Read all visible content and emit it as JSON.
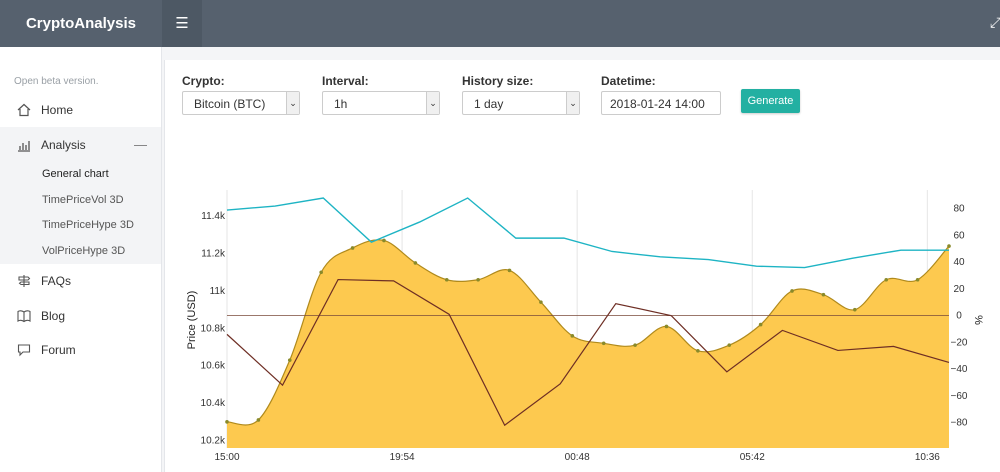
{
  "app": {
    "title": "CryptoAnalysis"
  },
  "sidebar": {
    "beta_note": "Open beta version.",
    "items": [
      {
        "label": "Home",
        "icon": "home-icon"
      },
      {
        "label": "Analysis",
        "icon": "bar-chart-icon",
        "expanded": true,
        "children": [
          "General chart",
          "TimePriceVol 3D",
          "TimePriceHype 3D",
          "VolPriceHype 3D"
        ]
      },
      {
        "label": "FAQs",
        "icon": "signpost-icon"
      },
      {
        "label": "Blog",
        "icon": "book-icon"
      },
      {
        "label": "Forum",
        "icon": "chat-icon"
      }
    ]
  },
  "form": {
    "crypto": {
      "label": "Crypto:",
      "value": "Bitcoin (BTC)"
    },
    "interval": {
      "label": "Interval:",
      "value": "1h"
    },
    "history": {
      "label": "History size:",
      "value": "1 day"
    },
    "datetime": {
      "label": "Datetime:",
      "value": "2018-01-24 14:00"
    },
    "generate_label": "Generate"
  },
  "colors": {
    "price_fill": "#fdc94f",
    "price_line": "#b08a1c",
    "teal": "#1eb4c4",
    "dark": "#6e2e24",
    "button": "#23b0a2"
  },
  "chart_data": {
    "type": "line",
    "ylabel": "Price (USD)",
    "y2label": "%",
    "x_ticks": [
      "15:00",
      "19:54",
      "00:48",
      "05:42",
      "10:36"
    ],
    "x": [
      0,
      1,
      2,
      3,
      4,
      5,
      6,
      7,
      8,
      9,
      10,
      11,
      12,
      13,
      14,
      15,
      16,
      17,
      18,
      19,
      20,
      21,
      22,
      23
    ],
    "y_ticks": [
      "10.2k",
      "10.4k",
      "10.6k",
      "10.8k",
      "11k",
      "11.2k",
      "11.4k"
    ],
    "ylim": [
      10160,
      11540
    ],
    "y2_ticks": [
      "80",
      "60",
      "40",
      "20",
      "0",
      "−20",
      "−40",
      "−60",
      "−80"
    ],
    "y2lim": [
      -99,
      94
    ],
    "series": [
      {
        "values": [
          10300,
          10310,
          10630,
          11100,
          11230,
          11270,
          11150,
          11060,
          11060,
          11110,
          10940,
          10760,
          10720,
          10710,
          10810,
          10680,
          10710,
          10820,
          11000,
          10980,
          10900,
          11060,
          11060,
          11240
        ]
      },
      {
        "values": [
          79,
          82,
          88,
          55,
          70,
          88,
          58,
          58,
          48,
          44,
          42,
          37,
          36,
          43,
          49,
          49
        ]
      },
      {
        "values": [
          -14,
          -52,
          27,
          26,
          1,
          -82,
          -51,
          9,
          0,
          -42,
          -11,
          -26,
          -23,
          -35
        ]
      }
    ]
  }
}
